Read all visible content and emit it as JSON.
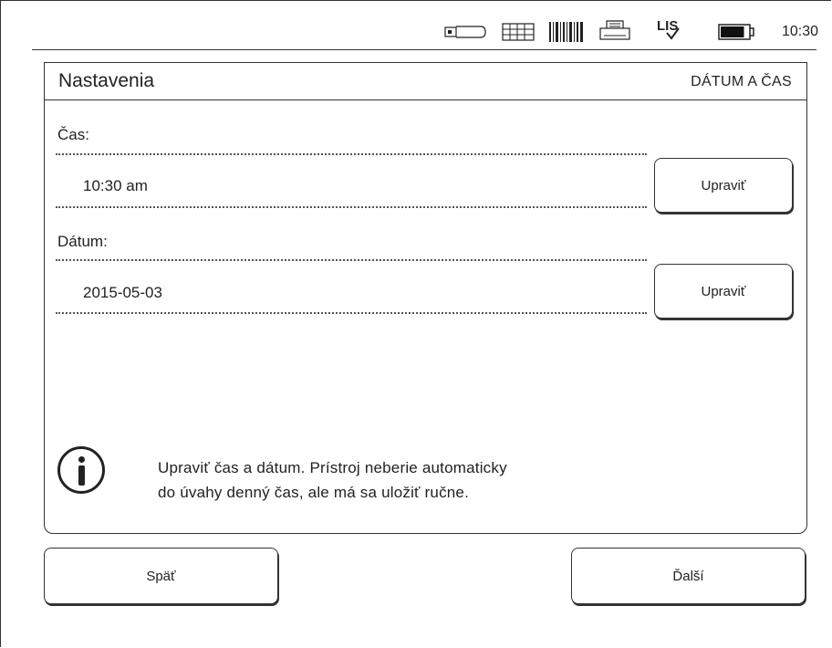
{
  "status_bar": {
    "time": "10:30",
    "lis_label": "LIS",
    "icons": [
      "usb-stick-icon",
      "keyboard-icon",
      "barcode-icon",
      "printer-icon",
      "lis-icon",
      "battery-icon"
    ],
    "battery_level": 0.85
  },
  "header": {
    "title": "Nastavenia",
    "section": "DÁTUM A ČAS"
  },
  "fields": [
    {
      "label": "Čas:",
      "value": "10:30 am",
      "button": "Upraviť"
    },
    {
      "label": "Dátum:",
      "value": "2015-05-03",
      "button": "Upraviť"
    }
  ],
  "info": {
    "icon": "info-icon",
    "line1": "Upraviť čas a dátum. Prístroj neberie automaticky",
    "line2": "do úvahy denný čas, ale má sa uložiť ručne."
  },
  "nav": {
    "back_label": "Späť",
    "next_label": "Ďalší"
  }
}
